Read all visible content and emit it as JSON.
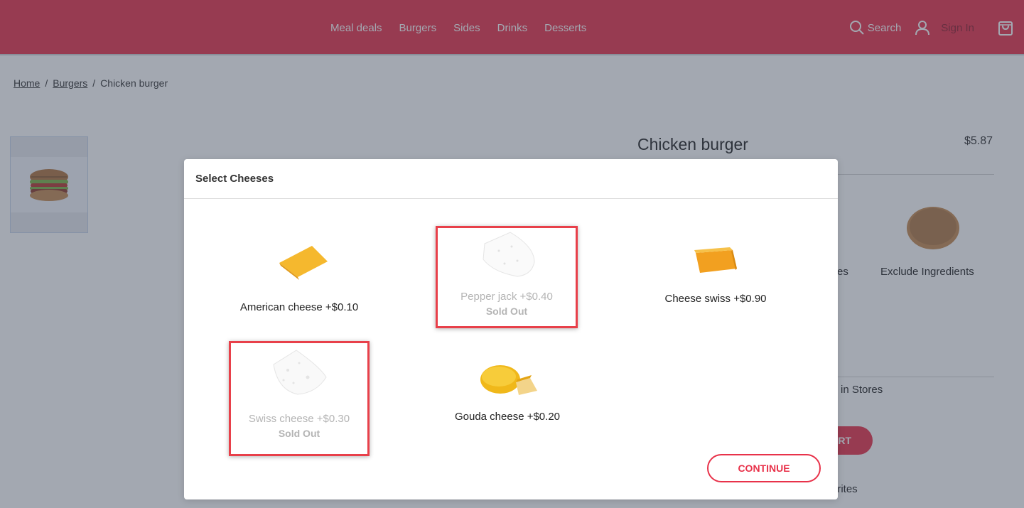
{
  "header": {
    "nav": [
      "Meal deals",
      "Burgers",
      "Sides",
      "Drinks",
      "Desserts"
    ],
    "search_label": "Search",
    "signin_label": "Sign In",
    "bg_color": "#e8324a"
  },
  "page": {
    "breadcrumb": {
      "home": "Home",
      "category": "Burgers",
      "current": "Chicken burger"
    },
    "product_title": "Chicken burger",
    "product_price": "$5.87",
    "option_partial": "es",
    "exclude_label": "Exclude Ingredients",
    "stores_partial": "in Stores",
    "add_partial": "RT",
    "favorites_partial": "orites"
  },
  "modal": {
    "title": "Select Cheeses",
    "items": [
      {
        "label": "American cheese +$0.10",
        "sold_out": false,
        "icon": "american-cheese-slice"
      },
      {
        "label": "Pepper jack +$0.40",
        "sold_out": true,
        "sold_out_label": "Sold Out",
        "icon": "pepper-jack-wedge"
      },
      {
        "label": "Cheese swiss +$0.90",
        "sold_out": false,
        "icon": "cheese-block"
      },
      {
        "label": "Swiss cheese +$0.30",
        "sold_out": true,
        "sold_out_label": "Sold Out",
        "icon": "swiss-cheese-wedge"
      },
      {
        "label": "Gouda cheese +$0.20",
        "sold_out": false,
        "icon": "gouda-wheel"
      }
    ],
    "continue_label": "CONTINUE",
    "accent": "#e8324a"
  }
}
